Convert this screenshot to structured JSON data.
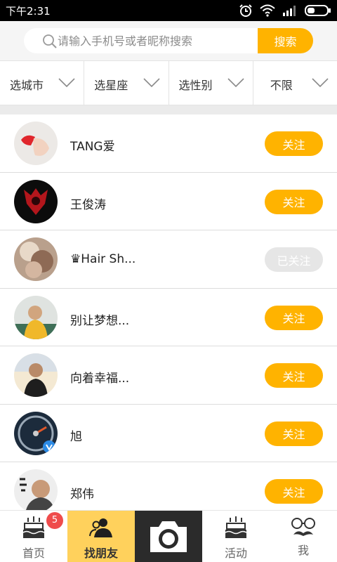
{
  "status_bar": {
    "time": "下午2:31",
    "icons": [
      "alarm-icon",
      "wifi-icon",
      "signal-icon",
      "battery-icon"
    ]
  },
  "search": {
    "placeholder": "请输入手机号或者昵称搜索",
    "button_label": "搜索"
  },
  "filters": [
    {
      "label": "选城市",
      "icon": "chevron-down-icon"
    },
    {
      "label": "选星座",
      "icon": "chevron-down-icon"
    },
    {
      "label": "选性别",
      "icon": "chevron-down-icon"
    },
    {
      "label": "不限",
      "icon": "chevron-down-icon"
    }
  ],
  "users": [
    {
      "name": "TANG爱",
      "action": "关注",
      "followed": false
    },
    {
      "name": "王俊涛",
      "action": "关注",
      "followed": false
    },
    {
      "name": "♛Hair Sh...",
      "action": "已关注",
      "followed": true
    },
    {
      "name": "别让梦想...",
      "action": "关注",
      "followed": false
    },
    {
      "name": "向着幸福...",
      "action": "关注",
      "followed": false
    },
    {
      "name": "旭",
      "action": "关注",
      "followed": false
    },
    {
      "name": "郑伟",
      "action": "关注",
      "followed": false
    }
  ],
  "tabs": [
    {
      "label": "首页",
      "icon": "cake-icon",
      "badge": "5"
    },
    {
      "label": "找朋友",
      "icon": "friends-icon",
      "active": true
    },
    {
      "label": "",
      "icon": "camera-icon"
    },
    {
      "label": "活动",
      "icon": "cake-icon"
    },
    {
      "label": "我",
      "icon": "mustache-glasses-icon"
    }
  ],
  "colors": {
    "accent": "#ffb300",
    "active_tab": "#ffd15c",
    "camera_tab": "#2b2b2b",
    "badge": "#ef4c4c",
    "followed_button": "#e6e6e6"
  }
}
